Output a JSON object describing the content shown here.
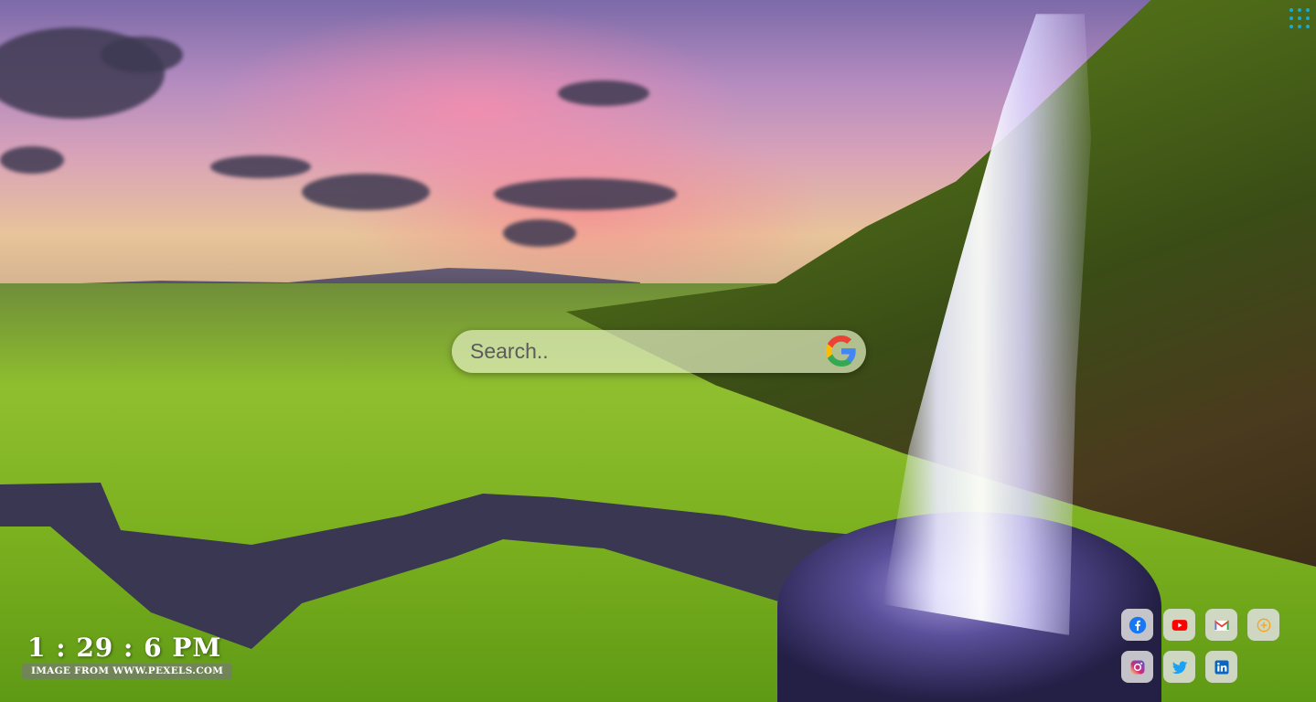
{
  "search": {
    "placeholder": "Search..",
    "value": ""
  },
  "clock": {
    "time": "1 : 29 : 6 PM"
  },
  "credit": {
    "text": "IMAGE FROM WWW.PEXELS.COM"
  },
  "apps_menu": {
    "icon": "apps-grid-icon",
    "color": "#18a9d8"
  },
  "search_engine_icon": "google-icon",
  "shortcuts": [
    {
      "name": "facebook",
      "icon": "facebook-icon",
      "color": "#1877f2"
    },
    {
      "name": "youtube",
      "icon": "youtube-icon",
      "color": "#ff0000"
    },
    {
      "name": "gmail",
      "icon": "gmail-icon",
      "color": "#ea4335"
    },
    {
      "name": "add",
      "icon": "add-shortcut-icon",
      "color": "#f4a51c"
    },
    {
      "name": "instagram",
      "icon": "instagram-icon",
      "color": "#c13584"
    },
    {
      "name": "twitter",
      "icon": "twitter-icon",
      "color": "#1da1f2"
    },
    {
      "name": "linkedin",
      "icon": "linkedin-icon",
      "color": "#0a66c2"
    }
  ]
}
